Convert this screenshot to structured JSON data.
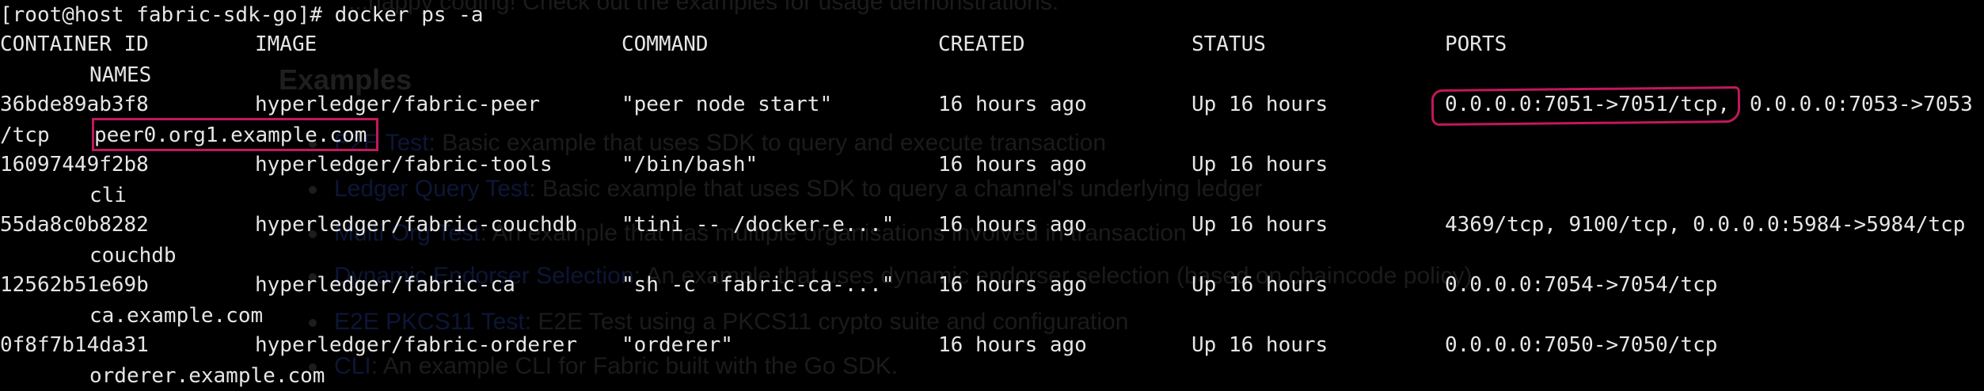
{
  "background_doc": {
    "intro_line": "...happy coding! Check out the examples for usage demonstrations.",
    "heading": "Examples",
    "bullets": [
      {
        "link": "E2E Test",
        "rest": ": Basic example that uses SDK to query and execute transaction"
      },
      {
        "link": "Ledger Query Test",
        "rest": ": Basic example that uses SDK to query a channel's underlying ledger"
      },
      {
        "link": "Multi Org Test",
        "rest": ": An example that has multiple organisations involved in transaction"
      },
      {
        "link": "Dynamic Endorser Selection",
        "rest": ": An example that uses dynamic endorser selection (based on chaincode policy)"
      },
      {
        "link": "E2E PKCS11 Test",
        "rest": ": E2E Test using a PKCS11 crypto suite and configuration"
      },
      {
        "link": "CLI",
        "rest": ": An example CLI for Fabric built with the Go SDK."
      }
    ]
  },
  "prompt": "[root@host fabric-sdk-go]# docker ps -a",
  "headers": {
    "container_id": "CONTAINER ID",
    "image": "IMAGE",
    "command": "COMMAND",
    "created": "CREATED",
    "status": "STATUS",
    "ports": "PORTS",
    "names": "NAMES"
  },
  "rows": [
    {
      "container_id": "36bde89ab3f8",
      "image": "hyperledger/fabric-peer",
      "command": "\"peer node start\"",
      "created": "16 hours ago",
      "status": "Up 16 hours",
      "ports_a": "0.0.0.0:7051->7051/tcp,",
      "ports_b": "0.0.0.0:7053->7053",
      "ports_wrap": "/tcp",
      "names": "peer0.org1.example.com"
    },
    {
      "container_id": "16097449f2b8",
      "image": "hyperledger/fabric-tools",
      "command": "\"/bin/bash\"",
      "created": "16 hours ago",
      "status": "Up 16 hours",
      "ports": "",
      "names": "cli"
    },
    {
      "container_id": "55da8c0b8282",
      "image": "hyperledger/fabric-couchdb",
      "command": "\"tini -- /docker-e...\"",
      "created": "16 hours ago",
      "status": "Up 16 hours",
      "ports": "4369/tcp, 9100/tcp, 0.0.0.0:5984->5984/tcp",
      "names": "couchdb"
    },
    {
      "container_id": "12562b51e69b",
      "image": "hyperledger/fabric-ca",
      "command": "\"sh -c 'fabric-ca-...\"",
      "created": "16 hours ago",
      "status": "Up 16 hours",
      "ports": "0.0.0.0:7054->7054/tcp",
      "names": "ca.example.com"
    },
    {
      "container_id": "0f8f7b14da31",
      "image": "hyperledger/fabric-orderer",
      "command": "\"orderer\"",
      "created": "16 hours ago",
      "status": "Up 16 hours",
      "ports": "0.0.0.0:7050->7050/tcp",
      "names": "orderer.example.com"
    }
  ],
  "colors": {
    "terminal_bg": "#000000",
    "terminal_fg": "#e6e6e6",
    "highlight": "#c2185b",
    "bg_doc_link": "#0d1636"
  }
}
